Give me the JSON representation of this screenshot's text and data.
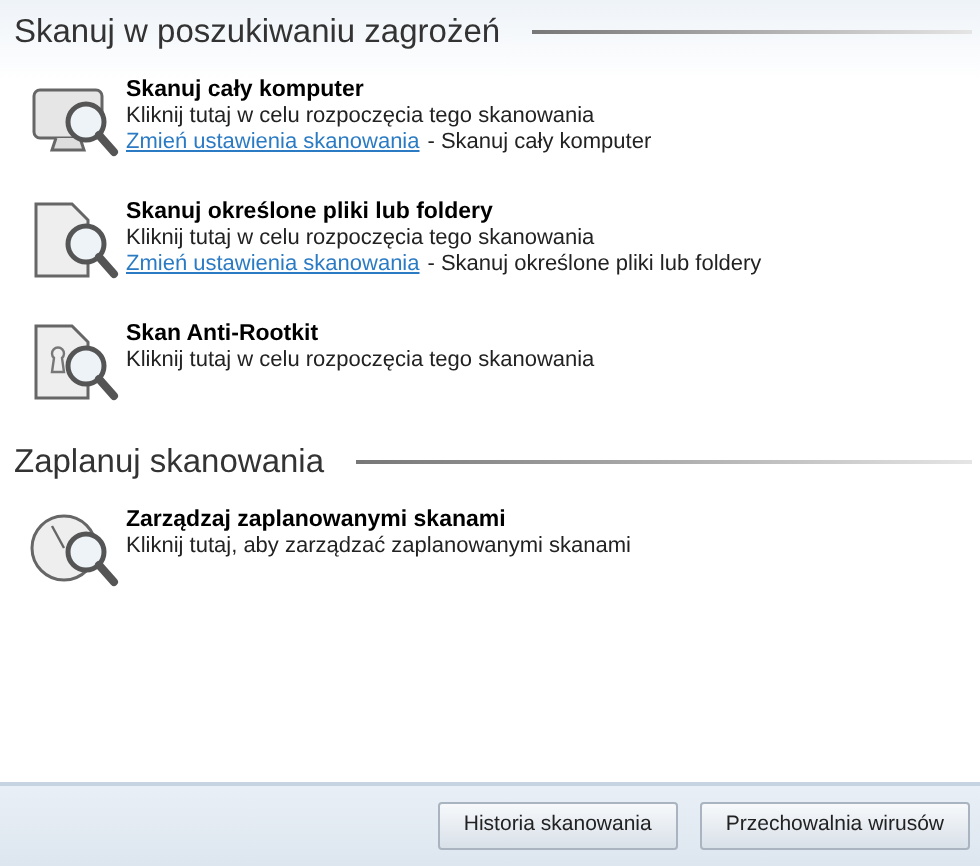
{
  "sections": [
    {
      "title": "Skanuj w poszukiwaniu zagrożeń",
      "items": [
        {
          "kind": "computer",
          "title": "Skanuj cały komputer",
          "description": "Kliknij tutaj w celu rozpoczęcia tego skanowania",
          "link": "Zmień ustawienia skanowania",
          "link_suffix": "- Skanuj cały komputer"
        },
        {
          "kind": "files",
          "title": "Skanuj określone pliki lub foldery",
          "description": "Kliknij tutaj w celu rozpoczęcia tego skanowania",
          "link": "Zmień ustawienia skanowania",
          "link_suffix": "- Skanuj określone pliki lub foldery"
        },
        {
          "kind": "rootkit",
          "title": "Skan Anti-Rootkit",
          "description": "Kliknij tutaj w celu rozpoczęcia tego skanowania"
        }
      ]
    },
    {
      "title": "Zaplanuj skanowania",
      "items": [
        {
          "kind": "schedule",
          "title": "Zarządzaj zaplanowanymi skanami",
          "description": "Kliknij tutaj, aby zarządzać zaplanowanymi skanami"
        }
      ]
    }
  ],
  "buttons": [
    "Historia skanowania",
    "Przechowalnia wirusów"
  ]
}
